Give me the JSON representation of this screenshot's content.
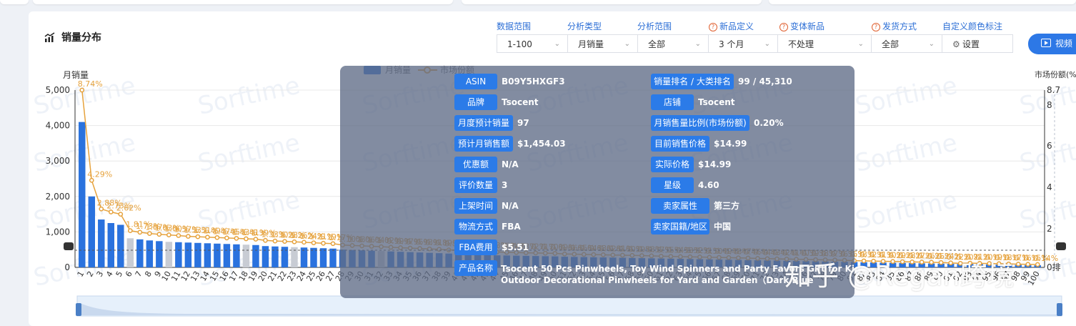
{
  "section": {
    "title": "销量分布"
  },
  "filters": [
    {
      "label": "数据范围",
      "value": "1-100",
      "help": false
    },
    {
      "label": "分析类型",
      "value": "月销量",
      "help": false
    },
    {
      "label": "分析范围",
      "value": "全部",
      "help": false
    },
    {
      "label": "新品定义",
      "value": "3 个月",
      "help": true
    },
    {
      "label": "变体新品",
      "value": "不处理",
      "help": true
    },
    {
      "label": "发货方式",
      "value": "全部",
      "help": true
    },
    {
      "label": "自定义颜色标注",
      "value": "设置",
      "help": false
    }
  ],
  "video_button": "视频",
  "chart_data": {
    "type": "bar",
    "title": "",
    "ylabel": "月销量",
    "y2label": "市场份额(%",
    "ylim": [
      0,
      5000
    ],
    "y_ticks": [
      "5,000",
      "4,000",
      "3,000",
      "2,000",
      "1,000",
      "0"
    ],
    "y2_ticks": [
      "8.7",
      "8",
      "6",
      "4",
      "2",
      "0排"
    ],
    "legend": [
      "月销量",
      "市场份额"
    ],
    "categories": [
      "1",
      "2",
      "3",
      "4",
      "5",
      "6",
      "7",
      "8",
      "9",
      "10",
      "11",
      "12",
      "13",
      "14",
      "15",
      "16",
      "17",
      "18",
      "19",
      "20",
      "21",
      "22",
      "23",
      "24",
      "25",
      "26",
      "27",
      "28",
      "29",
      "30",
      "31",
      "32",
      "33",
      "34",
      "35",
      "36",
      "37",
      "38",
      "39",
      "40",
      "41",
      "42",
      "43",
      "44",
      "45",
      "46",
      "47",
      "48",
      "49",
      "50",
      "51",
      "52",
      "53",
      "54",
      "55",
      "56",
      "57",
      "58",
      "59",
      "60",
      "61",
      "62",
      "63",
      "64",
      "65",
      "66",
      "67",
      "68",
      "69",
      "70",
      "71",
      "72",
      "73",
      "74",
      "75",
      "76",
      "77",
      "78",
      "79",
      "80",
      "81",
      "82",
      "83",
      "84",
      "85",
      "86",
      "87",
      "88",
      "89",
      "90",
      "91",
      "92",
      "93",
      "94",
      "95",
      "96",
      "97",
      "98",
      "99",
      "100"
    ],
    "series": [
      {
        "name": "月销量",
        "values": [
          4100,
          2000,
          1350,
          1250,
          1200,
          820,
          790,
          760,
          740,
          720,
          710,
          700,
          690,
          680,
          670,
          660,
          650,
          640,
          630,
          600,
          590,
          580,
          570,
          560,
          550,
          540,
          530,
          500,
          490,
          480,
          470,
          460,
          450,
          440,
          430,
          420,
          410,
          400,
          390,
          380,
          370,
          360,
          350,
          340,
          335,
          330,
          325,
          320,
          315,
          310,
          300,
          295,
          290,
          285,
          280,
          275,
          270,
          265,
          260,
          255,
          250,
          245,
          240,
          235,
          230,
          225,
          220,
          215,
          210,
          205,
          200,
          195,
          190,
          185,
          180,
          175,
          170,
          165,
          160,
          155,
          150,
          145,
          140,
          135,
          130,
          125,
          120,
          115,
          110,
          105,
          100,
          97,
          95,
          90,
          85,
          80,
          75,
          70,
          65,
          60
        ]
      },
      {
        "name": "市场份额",
        "values": [
          8.74,
          4.29,
          2.88,
          2.73,
          2.62,
          1.81,
          1.73,
          1.67,
          1.63,
          1.6,
          1.57,
          1.53,
          1.51,
          1.49,
          1.47,
          1.45,
          1.43,
          1.41,
          1.39,
          1.33,
          1.3,
          1.28,
          1.26,
          1.24,
          1.21,
          1.19,
          1.17,
          1.1,
          1.08,
          1.06,
          1.04,
          1.02,
          0.99,
          0.97,
          0.95,
          0.93,
          0.91,
          0.89,
          0.86,
          0.84,
          0.82,
          0.8,
          0.78,
          0.76,
          0.74,
          0.73,
          0.72,
          0.71,
          0.7,
          0.69,
          0.66,
          0.65,
          0.64,
          0.63,
          0.62,
          0.61,
          0.6,
          0.59,
          0.58,
          0.57,
          0.55,
          0.54,
          0.53,
          0.52,
          0.51,
          0.5,
          0.49,
          0.48,
          0.47,
          0.46,
          0.44,
          0.43,
          0.42,
          0.41,
          0.4,
          0.39,
          0.38,
          0.37,
          0.36,
          0.35,
          0.33,
          0.32,
          0.31,
          0.3,
          0.29,
          0.28,
          0.27,
          0.26,
          0.25,
          0.24,
          0.22,
          0.2,
          0.21,
          0.2,
          0.19,
          0.18,
          0.17,
          0.16,
          0.15,
          0.14
        ]
      }
    ],
    "grey_bars": [
      "6",
      "10",
      "18",
      "23",
      "32"
    ],
    "colors": {
      "bar": "#2a72de",
      "bar_alt": "#c8ccd4",
      "line": "#e6a23c"
    }
  },
  "tooltip": {
    "left": [
      {
        "k": "ASIN",
        "v": "B09Y5HXGF3"
      },
      {
        "k": "品牌",
        "v": "Tsocent"
      },
      {
        "k": "月度预计销量",
        "v": "97"
      },
      {
        "k": "预计月销售额",
        "v": "$1,454.03"
      },
      {
        "k": "优惠额",
        "v": "N/A"
      },
      {
        "k": "评价数量",
        "v": "3"
      },
      {
        "k": "上架时间",
        "v": "N/A"
      },
      {
        "k": "物流方式",
        "v": "FBA"
      },
      {
        "k": "FBA费用",
        "v": "$5.51"
      }
    ],
    "right": [
      {
        "k": "销量排名 / 大类排名",
        "v": "99 / 45,310"
      },
      {
        "k": "店铺",
        "v": "Tsocent"
      },
      {
        "k": "月销售量比例(市场份额)",
        "v": "0.20%"
      },
      {
        "k": "目前销售价格",
        "v": "$14.99"
      },
      {
        "k": "实际价格",
        "v": "$14.99"
      },
      {
        "k": "星级",
        "v": "4.60"
      },
      {
        "k": "卖家属性",
        "v": "第三方"
      },
      {
        "k": "卖家国籍/地区",
        "v": "中国"
      }
    ],
    "product_key": "产品名称",
    "product_line1": "Tsocent 50 Pcs Pinwheels, Toy Wind Spinners and Party Favors Gift for Kids",
    "product_line2": "Outdoor Decorational Pinwheels for Yard and Garden（Dark Blue"
  },
  "chart_watermark": "Sorftime",
  "watermark": "知乎 @Regan跨境"
}
